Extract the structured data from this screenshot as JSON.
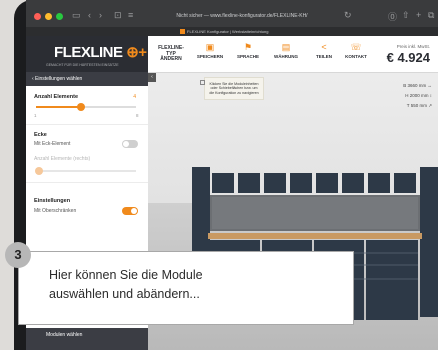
{
  "browser": {
    "url": "Nicht sicher — www.flexline-konfigurator.de/FLEXLINE-KH/",
    "tab_title": "FLEXLINE Konfigurator | Werkstatteinrichtung"
  },
  "header": {
    "brand": "FLEXLINE",
    "brand_plus": "⊕+",
    "tagline": "GEMACHT FÜR DIE HÄRTESTEN EINSÄTZE",
    "variant": "FLEXLINE-TYP ÄNDERN",
    "nav": [
      {
        "label": "SPEICHERN",
        "icon": "save-icon",
        "glyph": "💾"
      },
      {
        "label": "SPRACHE",
        "icon": "flag-icon",
        "glyph": "⚑"
      },
      {
        "label": "WÄHRUNG",
        "icon": "currency-icon",
        "glyph": "€"
      },
      {
        "label": "TEILEN",
        "icon": "share-icon",
        "glyph": "<"
      },
      {
        "label": "KONTAKT",
        "icon": "phone-icon",
        "glyph": "☎"
      }
    ],
    "price_label": "Preis inkl. MwSt.",
    "price": "€ 4.924"
  },
  "sidebar": {
    "back": "‹  Einstellungen wählen",
    "elements_title": "Anzahl Elemente",
    "elements_value": "4",
    "elements_fraction": 0.45,
    "slider_min": "1",
    "slider_max": "8",
    "corner_title": "Ecke",
    "corner_sub": "Mit Eck-Element",
    "corner_elements": "Anzahl Elemente (rechts)",
    "settings_title": "Einstellungen",
    "settings_sub": "Mit Oberschränken",
    "modules_button": "Modulen wählen"
  },
  "canvas": {
    "hint": "Klicken Sie die Moduleinheiten oder Schiebeflächen bzw. um die Konfiguration zu navigieren",
    "dims": [
      "B 3660 mm ↔",
      "H 2000 mm ↕",
      "T 550 mm ↗"
    ]
  },
  "step": "3",
  "callout": {
    "line1": "Hier können Sie die Module",
    "line2": "auswählen und abändern..."
  },
  "colors": {
    "accent": "#f08a1c",
    "dark": "#2b2d33",
    "cabinet": "#2d3947"
  }
}
